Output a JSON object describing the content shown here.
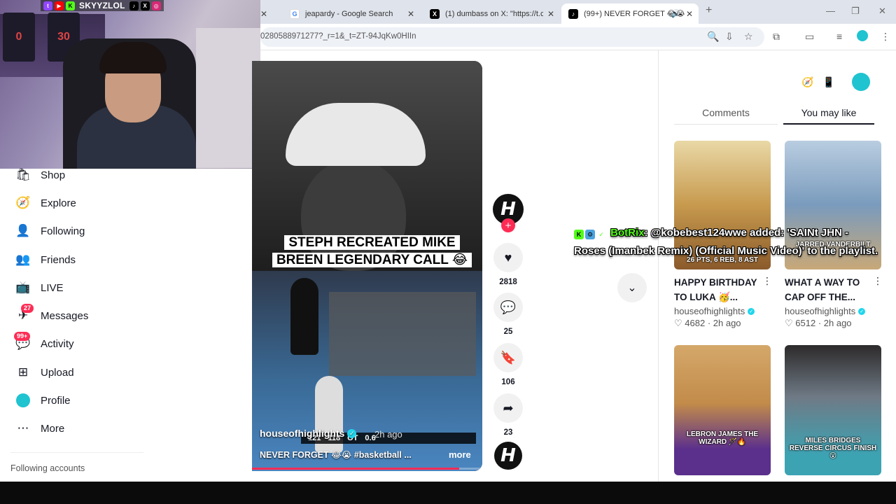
{
  "browser": {
    "tabs": [
      {
        "label": "jeapardy - Google Search",
        "favicon": "G",
        "color": "#4285f4",
        "active": false
      },
      {
        "label": "(1) dumbass on X: \"https://t.co/",
        "favicon": "X",
        "color": "#000000",
        "active": false
      },
      {
        "label": "(99+) NEVER FORGET 😂😭",
        "favicon": "♪",
        "color": "#000000",
        "active": true
      }
    ],
    "url": "0280588971277?_r=1&_t=ZT-94JqKw0HIIn"
  },
  "stream": {
    "handle": "SKYYZLOL",
    "jerseys": [
      "0",
      "30"
    ]
  },
  "sidebar": {
    "items": [
      {
        "label": "Shop",
        "icon": "shop-icon"
      },
      {
        "label": "Explore",
        "icon": "compass-icon"
      },
      {
        "label": "Following",
        "icon": "following-icon"
      },
      {
        "label": "Friends",
        "icon": "friends-icon"
      },
      {
        "label": "LIVE",
        "icon": "live-icon"
      },
      {
        "label": "Messages",
        "icon": "messages-icon",
        "badge": "27"
      },
      {
        "label": "Activity",
        "icon": "activity-icon",
        "badge": "99+"
      },
      {
        "label": "Upload",
        "icon": "upload-icon"
      },
      {
        "label": "Profile",
        "icon": "profile-icon"
      },
      {
        "label": "More",
        "icon": "more-icon"
      }
    ],
    "following_accounts": "Following accounts"
  },
  "video": {
    "headline_line1": "STEPH RECREATED MIKE",
    "headline_line2": "BREEN LEGENDARY CALL 😂",
    "author": "houseofhighlights",
    "time": "2h ago",
    "description": "NEVER FORGET 😂😭 #basketball ...",
    "more": "more",
    "scoreboard": [
      "121",
      "118",
      "OT",
      "0.6"
    ],
    "progress": 0.9,
    "avatar_letter": "H"
  },
  "actions": {
    "likes": "2818",
    "comments": "25",
    "saves": "106",
    "shares": "23"
  },
  "chat": {
    "user": "BotRix",
    "message": ": @kobebest124wwe added: 'SAINt JHN - Roses (Imanbek Remix) (Official Music Video)' to the playlist."
  },
  "panel": {
    "tab_comments": "Comments",
    "tab_you_may_like": "You may like",
    "cards": [
      {
        "title": "HAPPY BIRTHDAY TO LUKA 🥳...",
        "author": "houseofhighlights",
        "likes": "4682",
        "time": "2h ago",
        "overlay": "26 PTS, 6 REB, 8 AST"
      },
      {
        "title": "WHAT A WAY TO CAP OFF THE...",
        "author": "houseofhighlights",
        "likes": "6512",
        "time": "2h ago",
        "overlay": "JARRED VANDERBILT"
      },
      {
        "title": "",
        "author": "",
        "likes": "",
        "time": "",
        "overlay": "LEBRON JAMES THE WIZARD 🪄🔥"
      },
      {
        "title": "",
        "author": "",
        "likes": "",
        "time": "",
        "overlay": "MILES BRIDGES REVERSE CIRCUS FINISH 😮"
      }
    ]
  }
}
